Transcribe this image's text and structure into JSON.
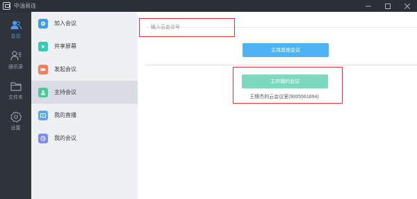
{
  "window": {
    "title": "中油易连"
  },
  "nav": {
    "items": [
      {
        "label": "会议",
        "icon": "people-icon",
        "active": true
      },
      {
        "label": "通讯录",
        "icon": "contacts-icon",
        "active": false
      },
      {
        "label": "文件夹",
        "icon": "folder-icon",
        "active": false
      },
      {
        "label": "设置",
        "icon": "settings-gear-icon",
        "active": false
      }
    ]
  },
  "menu": {
    "items": [
      {
        "label": "加入会议",
        "icon": "join-meeting-icon",
        "color": "#3d9df2",
        "active": false
      },
      {
        "label": "共享屏幕",
        "icon": "share-screen-icon",
        "color": "#3bc9b5",
        "active": false
      },
      {
        "label": "发起会议",
        "icon": "start-meeting-icon",
        "color": "#f47f5c",
        "active": false
      },
      {
        "label": "主持会议",
        "icon": "host-meeting-icon",
        "color": "#48c999",
        "active": true
      },
      {
        "label": "我的直播",
        "icon": "live-stream-icon",
        "color": "#5aa7ee",
        "active": false
      },
      {
        "label": "我的会议",
        "icon": "my-meeting-icon",
        "color": "#7e8bf0",
        "active": false
      }
    ]
  },
  "content": {
    "meeting_input_placeholder": "输入云会议号",
    "host_other_button": "主持其他会议",
    "host_mine_button": "主持我的会议",
    "room_info": "王臻杰的云会议室(9005561894)"
  },
  "colors": {
    "nav_bg": "#2f333c",
    "menu_bg": "#eff0f4",
    "accent_blue": "#4db3f5",
    "accent_green": "#7dd9bd",
    "highlight_red": "#e5333a"
  }
}
